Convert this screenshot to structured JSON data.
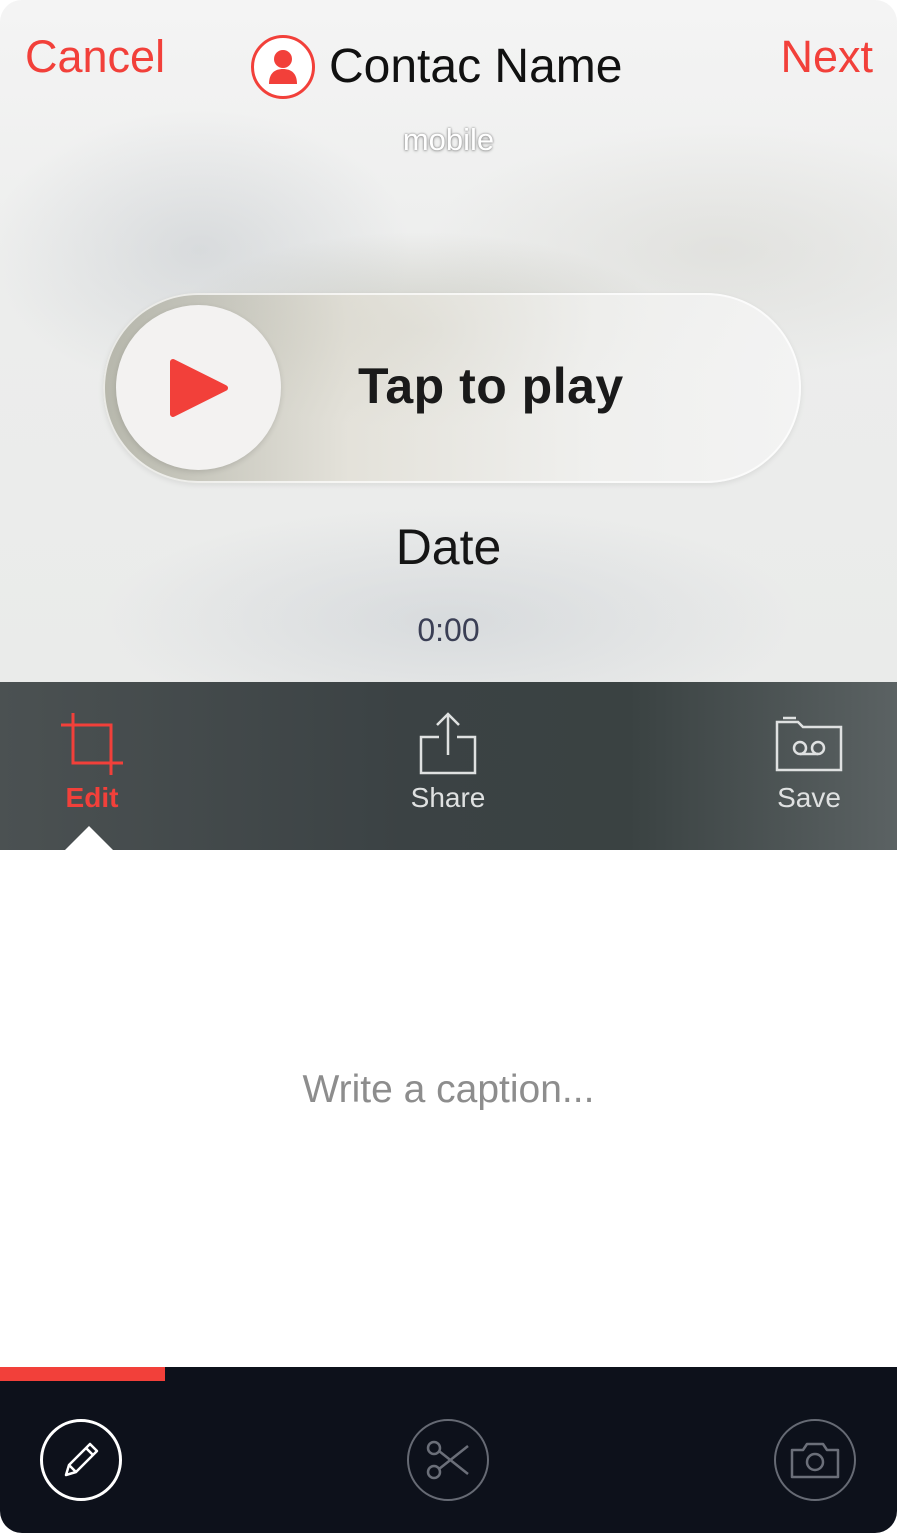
{
  "header": {
    "cancel_label": "Cancel",
    "next_label": "Next",
    "contact_name": "Contac Name",
    "contact_subtitle": "mobile"
  },
  "player": {
    "label": "Tap to play",
    "date": "Date",
    "duration": "0:00"
  },
  "toolbar": {
    "items": [
      {
        "label": "Edit",
        "icon": "crop-icon",
        "selected": true
      },
      {
        "label": "Share",
        "icon": "share-icon",
        "selected": false
      },
      {
        "label": "Save",
        "icon": "voicemail-folder-icon",
        "selected": false
      }
    ]
  },
  "caption": {
    "placeholder": "Write a caption..."
  },
  "progress": {
    "fraction": 0.184
  },
  "bottom_bar": {
    "icons": [
      "pencil-icon",
      "scissors-icon",
      "camera-icon"
    ]
  },
  "colors": {
    "accent": "#f2403a",
    "toolbar_bg": "#3b4244",
    "bottom_bar_bg": "#0d111b"
  }
}
